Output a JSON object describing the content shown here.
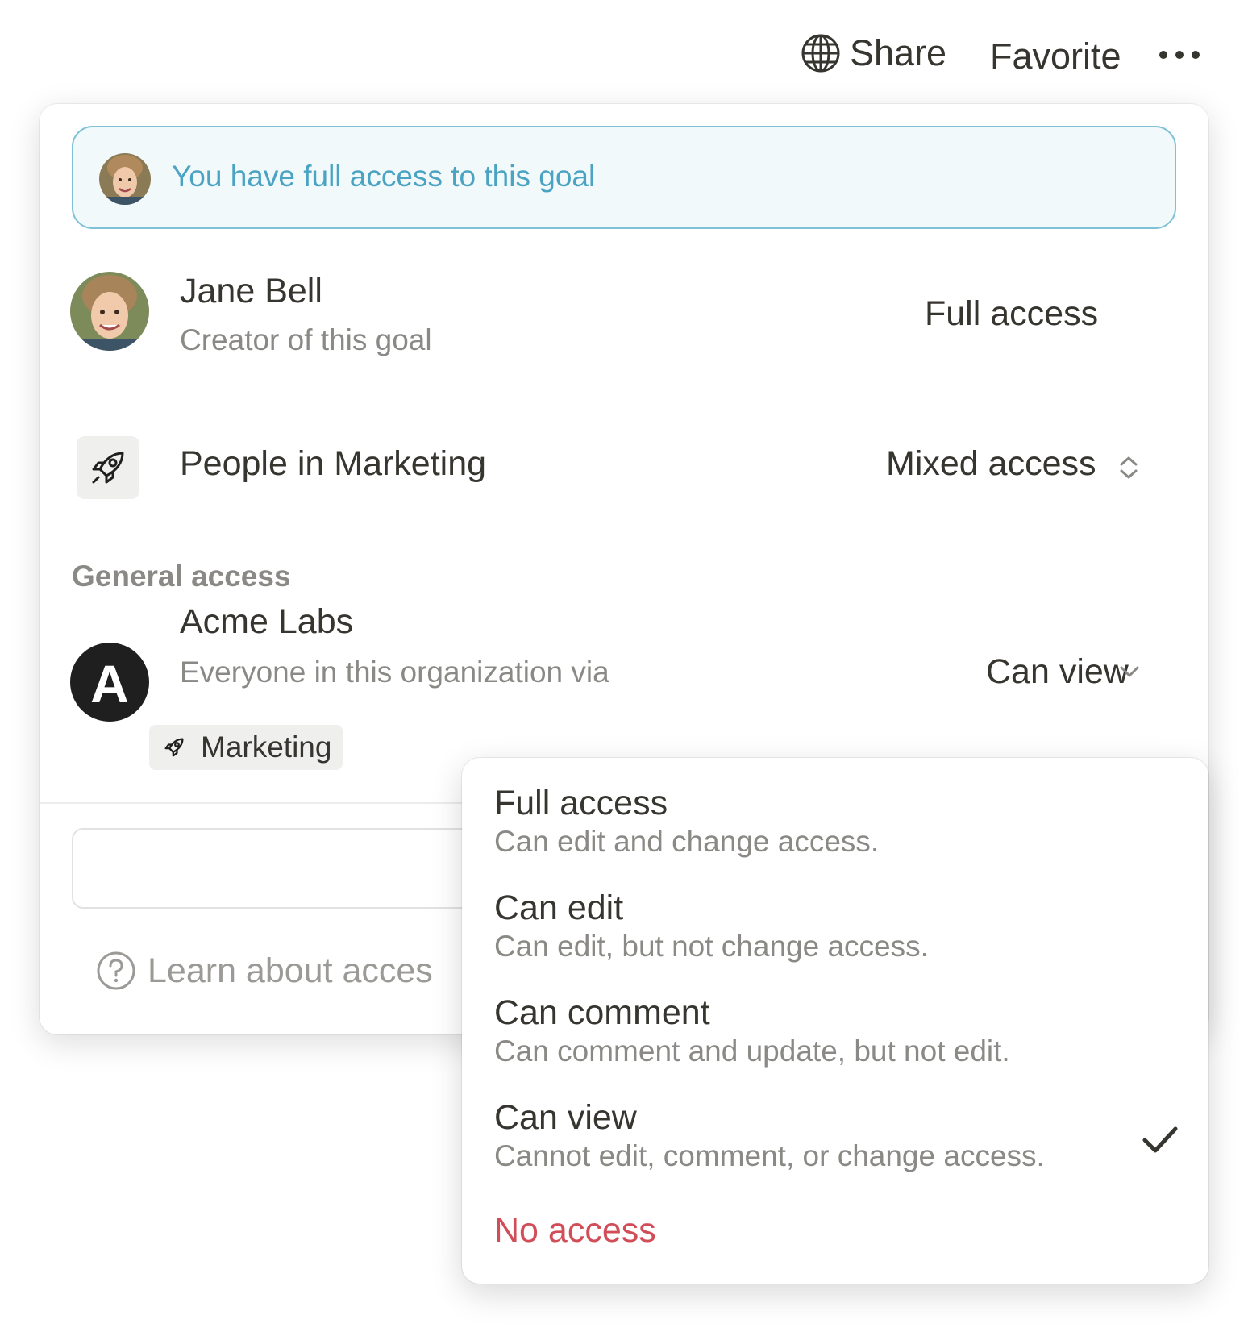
{
  "topbar": {
    "share_label": "Share",
    "share_icon": "globe-icon",
    "favorite_label": "Favorite",
    "more_icon": "ellipsis-icon"
  },
  "banner": {
    "text": "You have full access to this goal"
  },
  "people": [
    {
      "name": "Jane Bell",
      "subtitle": "Creator of this goal",
      "access": "Full access"
    },
    {
      "name": "People in Marketing",
      "icon": "rocket-icon",
      "access": "Mixed access"
    }
  ],
  "general_access": {
    "label": "General access",
    "org_name": "Acme Labs",
    "org_logo_letter": "A",
    "org_subtitle": "Everyone in this organization via",
    "tag_label": "Marketing",
    "access": "Can view"
  },
  "footer": {
    "learn_label": "Learn about acces"
  },
  "menu": {
    "options": [
      {
        "title": "Full access",
        "description": "Can edit and change access."
      },
      {
        "title": "Can edit",
        "description": "Can edit, but not change access."
      },
      {
        "title": "Can comment",
        "description": "Can comment and update, but not edit."
      },
      {
        "title": "Can view",
        "description": "Cannot edit, comment, or change access.",
        "selected": true
      },
      {
        "title": "No access",
        "description": ""
      }
    ]
  },
  "colors": {
    "banner_text": "#4aa3c2",
    "banner_border": "#7fc1d6",
    "danger": "#d14d57"
  }
}
